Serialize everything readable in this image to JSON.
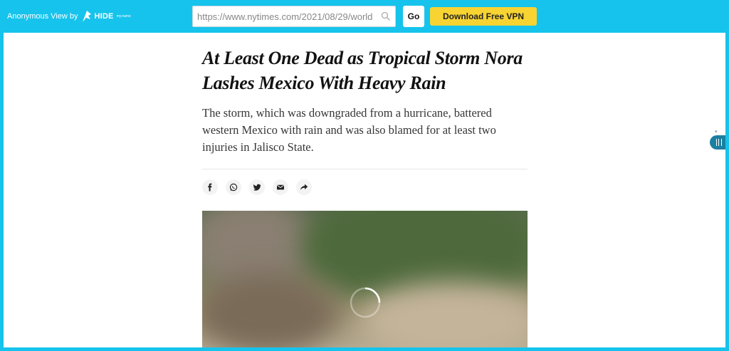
{
  "topbar": {
    "brand_label": "Anonymous View by",
    "logo_text": "HIDE",
    "logo_sup": "my.name",
    "url_value": "https://www.nytimes.com/2021/08/29/world",
    "go_label": "Go",
    "vpn_label": "Download Free VPN"
  },
  "article": {
    "headline": "At Least One Dead as Tropical Storm Nora Lashes Mexico With Heavy Rain",
    "summary": "The storm, which was downgraded from a hurricane, battered western Mexico with rain and was also blamed for at least two injuries in Jalisco State."
  },
  "share_icons": [
    "facebook-icon",
    "whatsapp-icon",
    "twitter-icon",
    "email-icon",
    "share-arrow-icon"
  ],
  "colors": {
    "topbar_bg": "#16c3ec",
    "vpn_button": "#f7d432",
    "sidebar_tab": "#1b7fa0"
  }
}
